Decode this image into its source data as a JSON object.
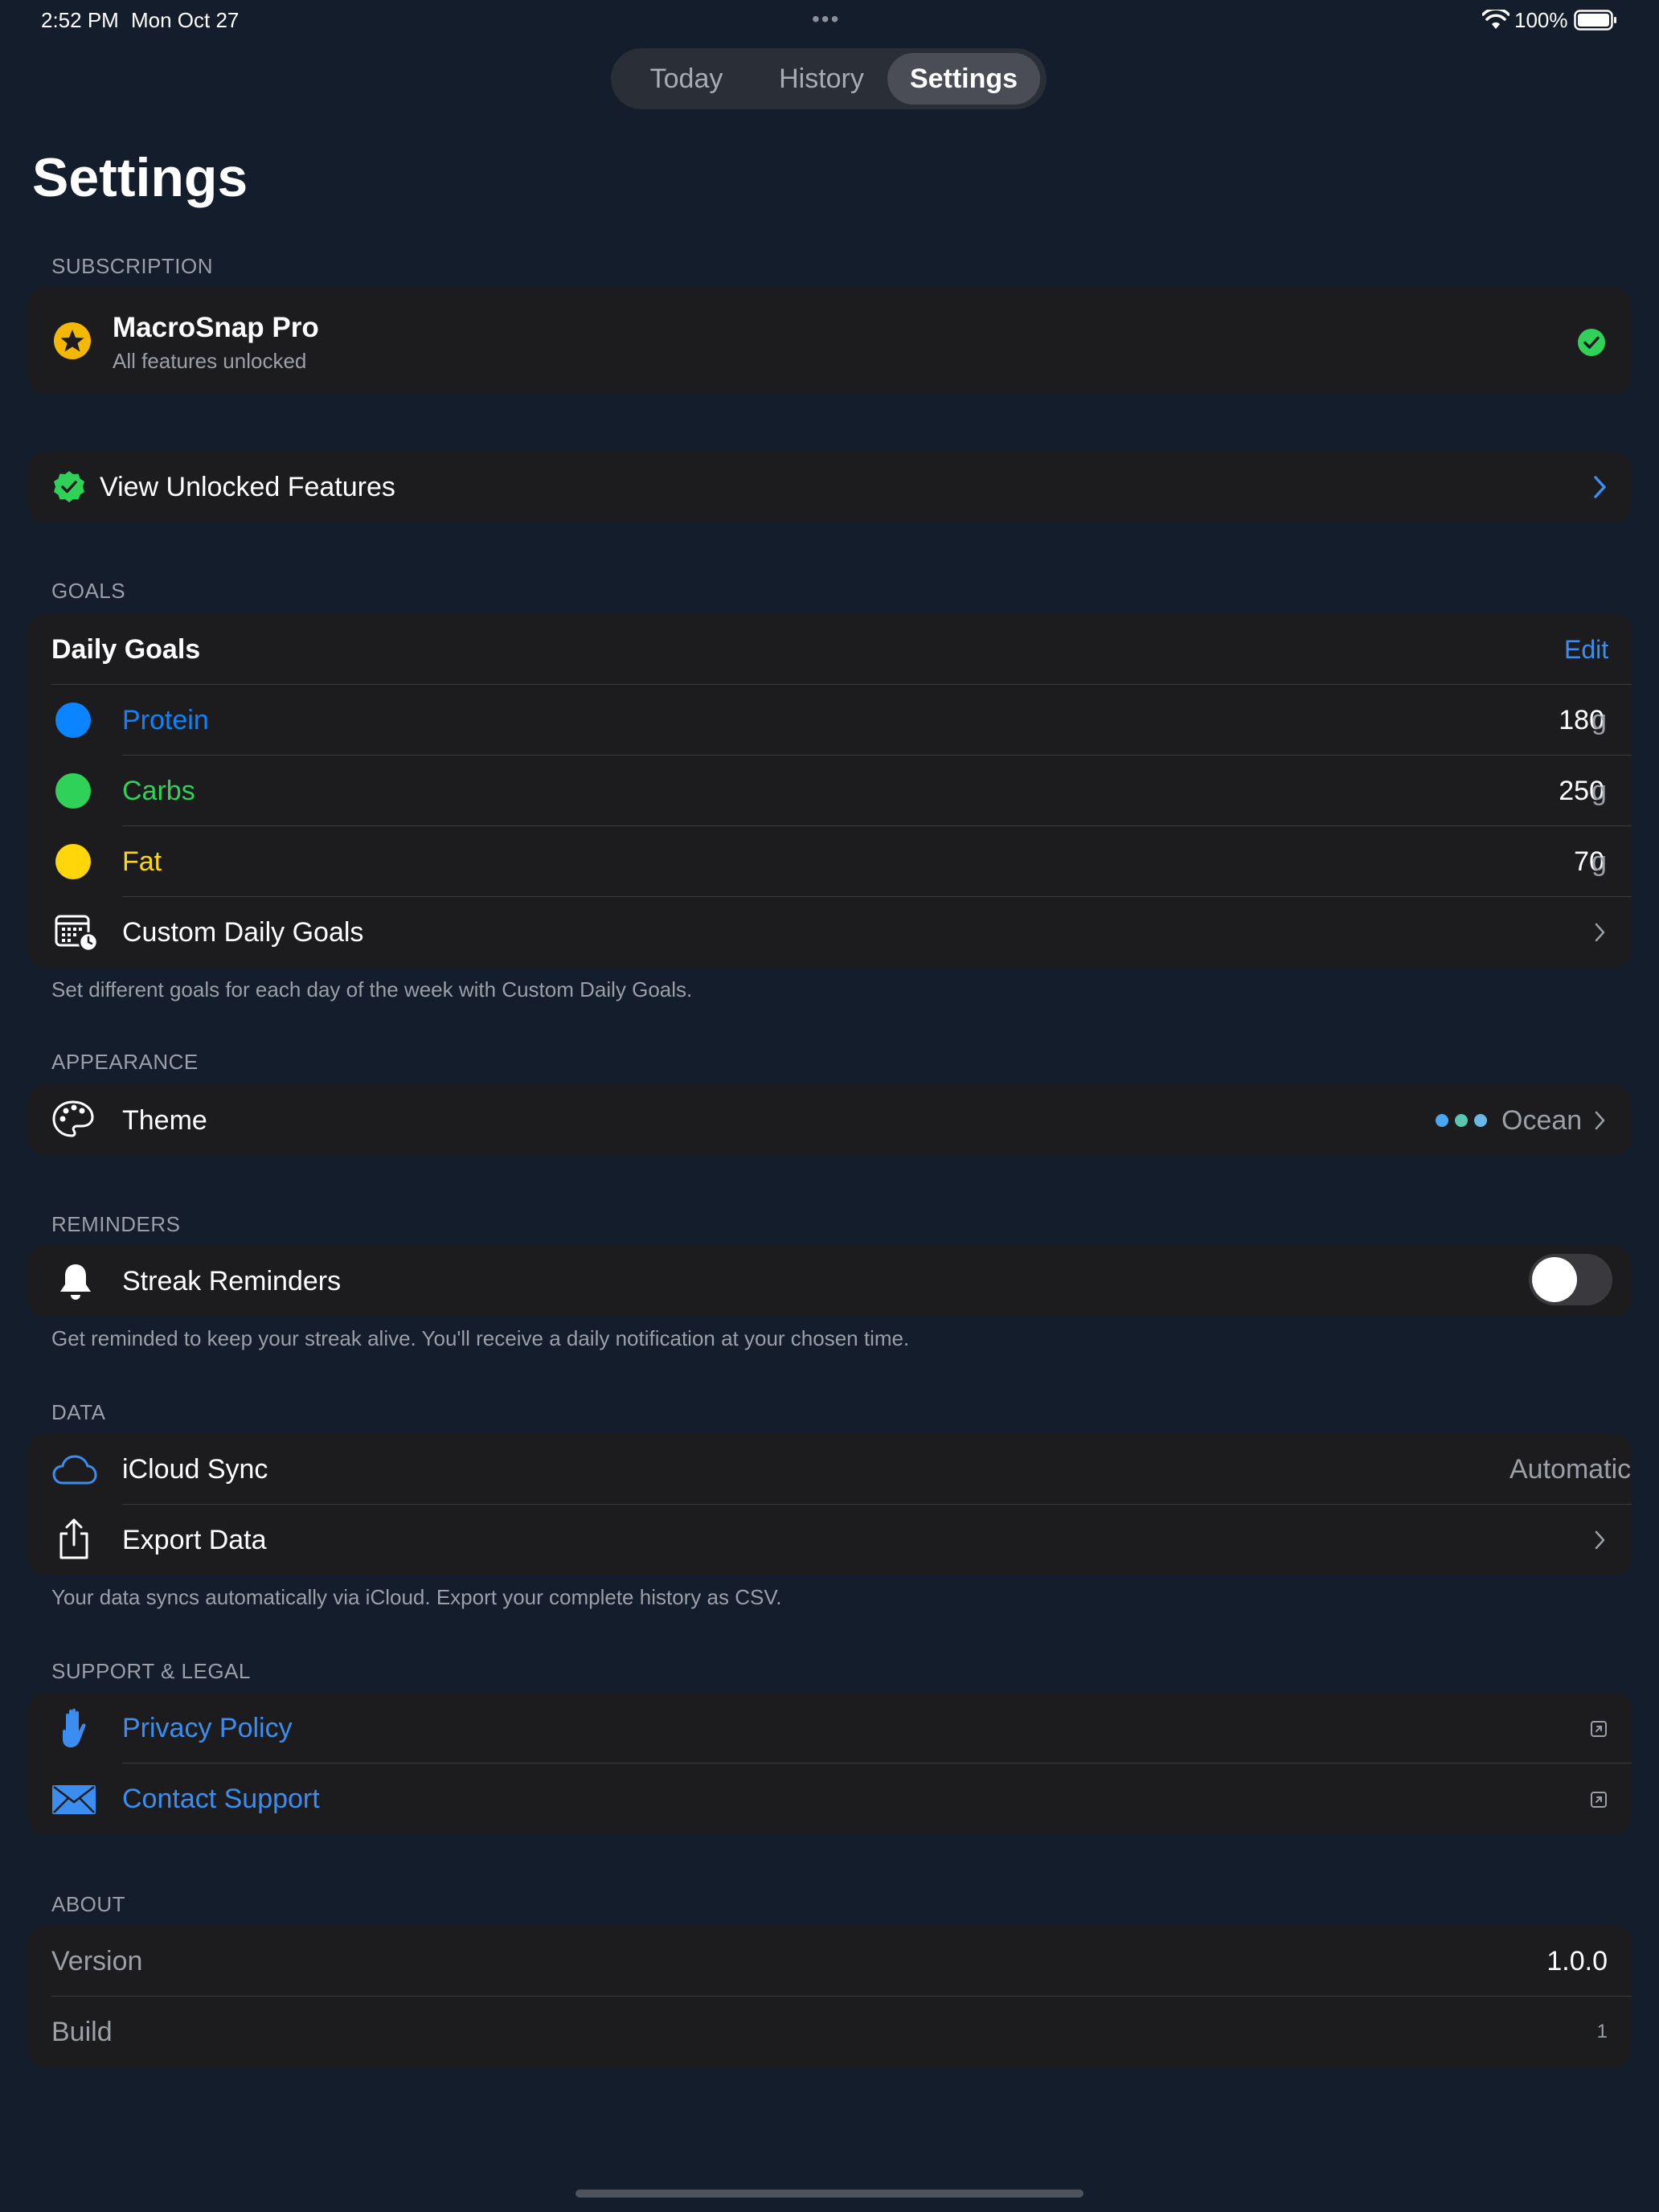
{
  "status_bar": {
    "time": "2:52 PM",
    "date": "Mon Oct 27",
    "battery": "100%"
  },
  "tabs": [
    {
      "label": "Today",
      "active": false
    },
    {
      "label": "History",
      "active": false
    },
    {
      "label": "Settings",
      "active": true
    }
  ],
  "page_title": "Settings",
  "subscription": {
    "header": "SUBSCRIPTION",
    "title": "MacroSnap Pro",
    "subtitle": "All features unlocked",
    "view_features": "View Unlocked Features"
  },
  "goals": {
    "header": "GOALS",
    "title": "Daily Goals",
    "edit_label": "Edit",
    "items": [
      {
        "name": "Protein",
        "value": "180",
        "unit": "g",
        "color": "#0a84ff"
      },
      {
        "name": "Carbs",
        "value": "250",
        "unit": "g",
        "color": "#30d158"
      },
      {
        "name": "Fat",
        "value": "70",
        "unit": "g",
        "color": "#ffd60a"
      }
    ],
    "custom_label": "Custom Daily Goals",
    "footer": "Set different goals for each day of the week with Custom Daily Goals."
  },
  "appearance": {
    "header": "APPEARANCE",
    "theme_label": "Theme",
    "theme_value": "Ocean",
    "theme_colors": [
      "#4aa8f0",
      "#5bc7b0",
      "#6ab8e8"
    ]
  },
  "reminders": {
    "header": "REMINDERS",
    "streak_label": "Streak Reminders",
    "streak_enabled": false,
    "footer": "Get reminded to keep your streak alive. You'll receive a daily notification at your chosen time."
  },
  "data_section": {
    "header": "DATA",
    "icloud_label": "iCloud Sync",
    "icloud_value": "Automatic",
    "export_label": "Export Data",
    "footer": "Your data syncs automatically via iCloud. Export your complete history as CSV."
  },
  "support": {
    "header": "SUPPORT & LEGAL",
    "privacy_label": "Privacy Policy",
    "contact_label": "Contact Support"
  },
  "about": {
    "header": "ABOUT",
    "version_label": "Version",
    "version_value": "1.0.0",
    "build_label": "Build",
    "build_value": "1"
  },
  "colors": {
    "background": "#141d2b",
    "card": "#1c1c1e",
    "accent_blue": "#3b8ef0",
    "check_green": "#30d158",
    "pro_gold": "#f5b800"
  }
}
